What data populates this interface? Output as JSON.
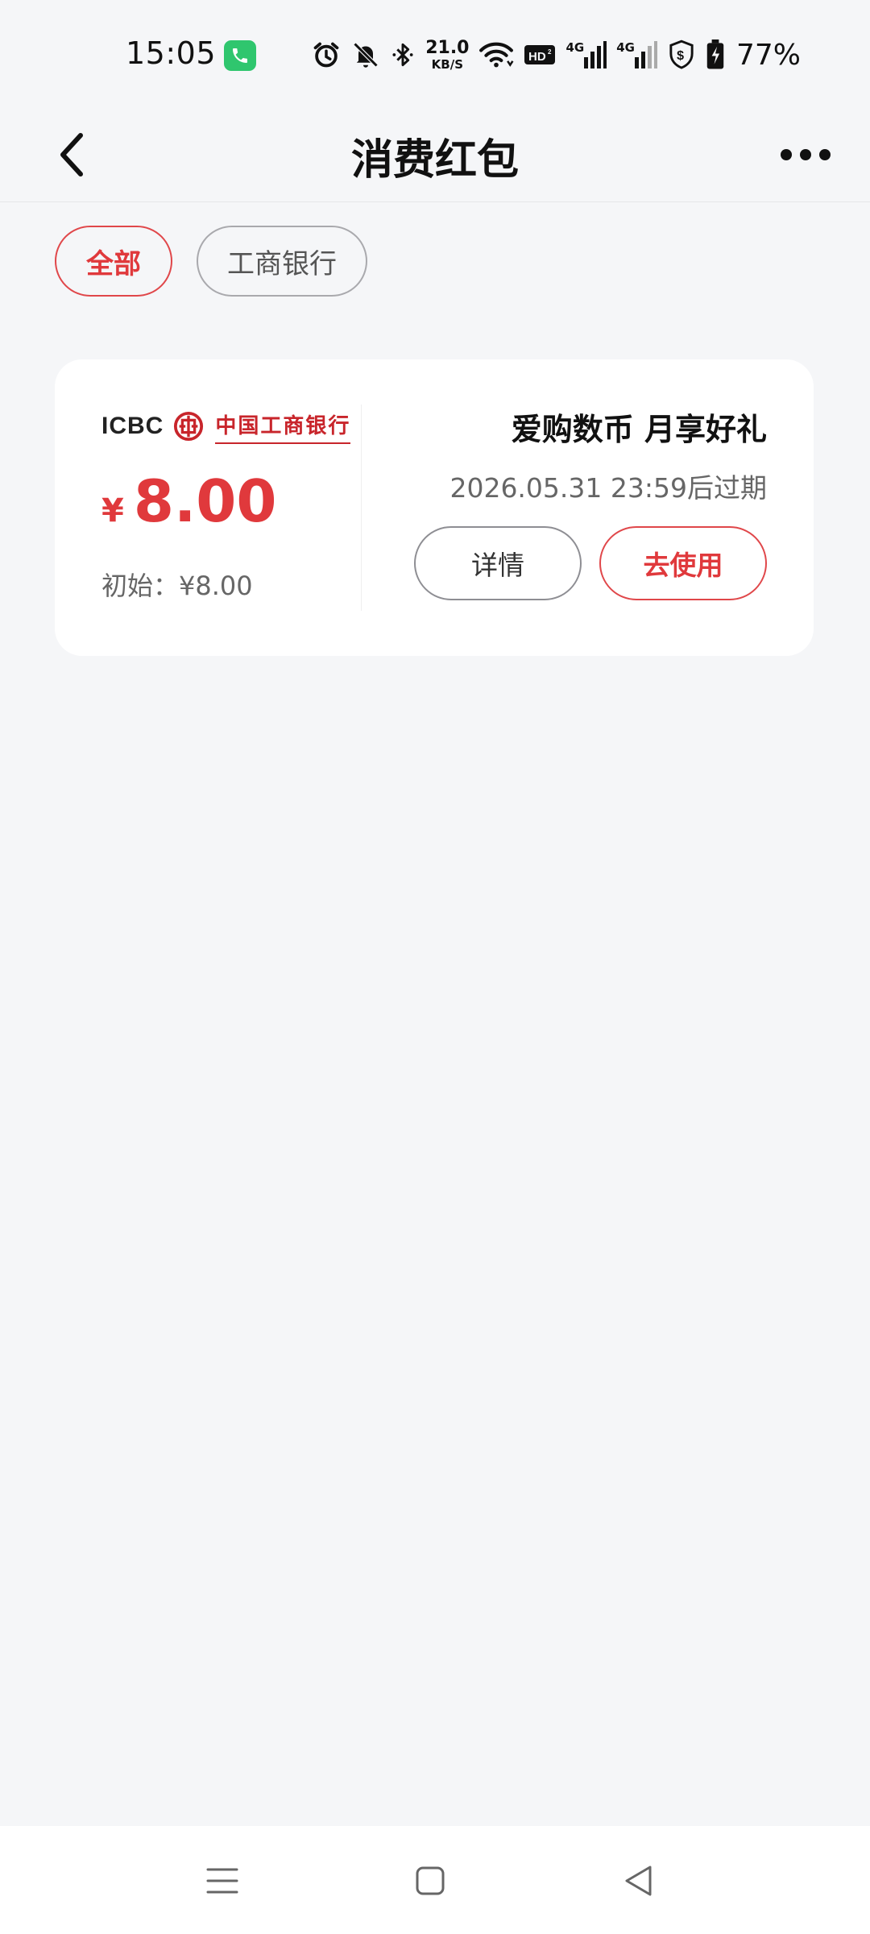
{
  "status_bar": {
    "time": "15:05",
    "network_speed_value": "21.0",
    "network_speed_unit": "KB/S",
    "hd_label": "HD",
    "signal_1_label": "4G",
    "signal_2_label": "4G",
    "battery_percent": "77%",
    "icons": [
      "call-active-icon",
      "alarm-icon",
      "mute-icon",
      "bluetooth-icon",
      "wifi-icon",
      "hd-icon",
      "signal-icon",
      "signal-icon",
      "shield-icon",
      "battery-charging-icon"
    ]
  },
  "header": {
    "title": "消费红包",
    "back_icon": "chevron-left-icon",
    "more_icon": "more-dots-icon"
  },
  "filters": [
    {
      "label": "全部",
      "active": true
    },
    {
      "label": "工商银行",
      "active": false
    }
  ],
  "coupon": {
    "bank_logo_text": "ICBC",
    "bank_name": "中国工商银行",
    "currency_symbol": "¥",
    "amount": "8.00",
    "initial_text": "初始：¥8.00",
    "title": "爱购数币 月享好礼",
    "expiry": "2026.05.31 23:59后过期",
    "detail_button": "详情",
    "use_button": "去使用"
  },
  "nav_bar": {
    "icons": [
      "menu-icon",
      "home-square-icon",
      "back-triangle-icon"
    ]
  },
  "colors": {
    "accent_red": "#e0393c",
    "bank_red": "#c8252b",
    "background": "#f5f6f8",
    "call_green": "#2fc66e"
  }
}
